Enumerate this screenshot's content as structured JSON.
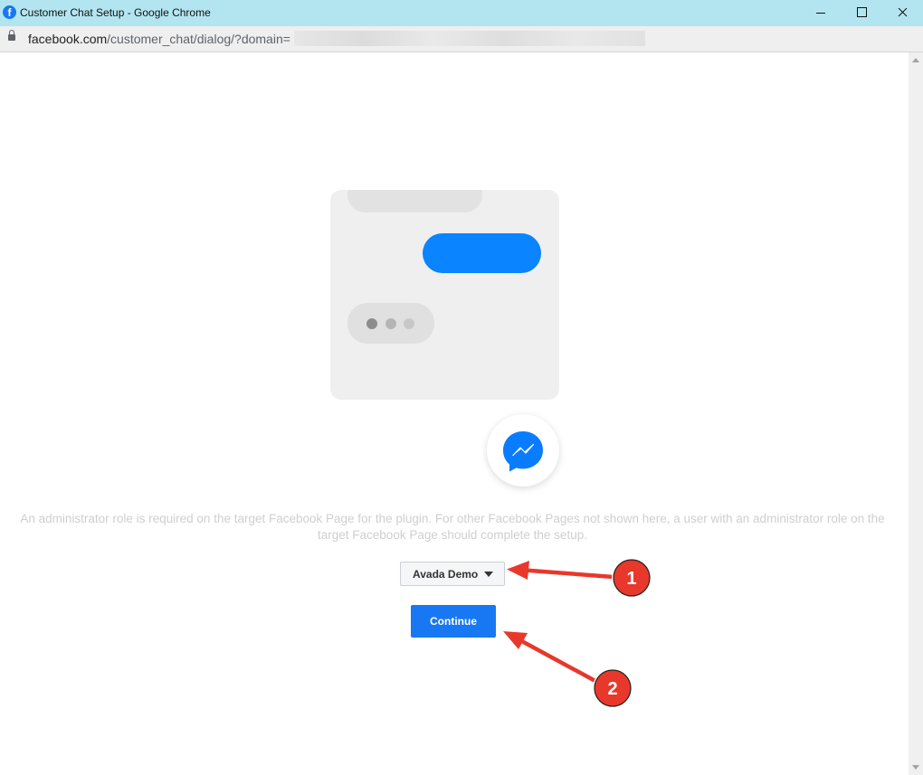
{
  "window": {
    "title": "Customer Chat Setup - Google Chrome",
    "favicon_letter": "f"
  },
  "address": {
    "host": "facebook.com",
    "path": "/customer_chat/dialog/?domain="
  },
  "dialog": {
    "info_text": "An administrator role is required on the target Facebook Page for the plugin. For other Facebook Pages not shown here, a user with an administrator role on the target Facebook Page should complete the setup.",
    "page_select_value": "Avada Demo",
    "continue_label": "Continue"
  },
  "annotations": [
    {
      "number": "1"
    },
    {
      "number": "2"
    }
  ],
  "colors": {
    "titlebar": "#b3e5f1",
    "brand_blue": "#1877f2",
    "messenger_blue": "#0a84ff",
    "annotation_red": "#e8382b"
  }
}
